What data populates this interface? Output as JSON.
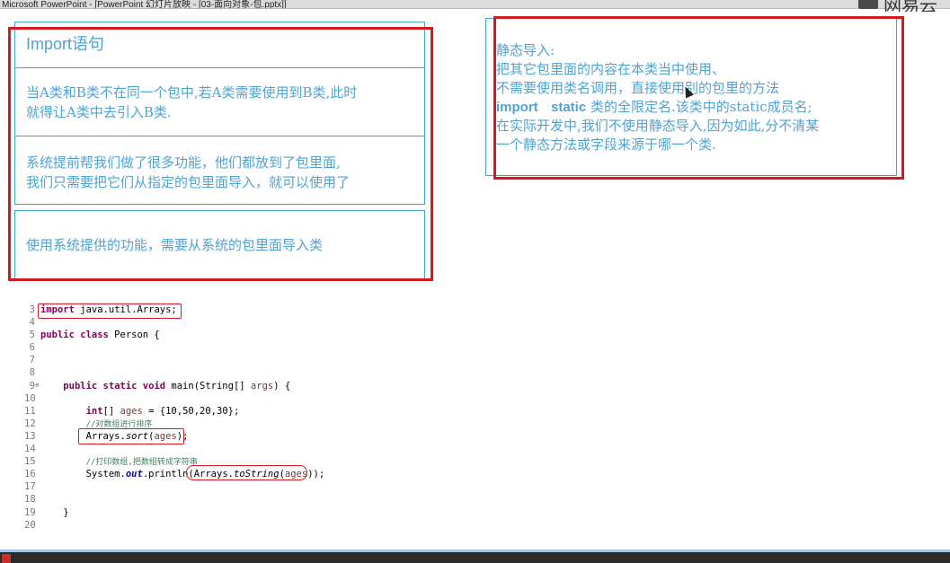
{
  "window": {
    "title": "Microsoft PowerPoint - [PowerPoint 幻灯片放映 - [03-面向对象-包.pptx]]"
  },
  "logo": {
    "text": "网易云"
  },
  "left_table": {
    "title": "Import语句",
    "row1": [
      "当A类和B类不在同一个包中,若A类需要使用到B类,此时",
      "就得让A类中去引入B类."
    ],
    "row2": [
      "系统提前帮我们做了很多功能，他们都放到了包里面,",
      "我们只需要把它们从指定的包里面导入，就可以使用了"
    ],
    "row3": [
      "使用系统提供的功能，需要从系统的包里面导入类"
    ]
  },
  "right_panel": {
    "line1": "静态导入:",
    "line2": "把其它包里面的内容在本类当中使用、",
    "line3": "不需要使用类名调用，直接使用别的包里的方法",
    "line4_kw1": "import",
    "line4_kw2": "static",
    "line4_rest": " 类的全限定名.该类中的static成员名;",
    "line5": "在实际开发中,我们不使用静态导入,因为如此,分不清某",
    "line6": "一个静态方法或字段来源于哪一个类."
  },
  "code": {
    "ln": [
      "3",
      "4",
      "5",
      "6",
      "7",
      "8",
      "9",
      "10",
      "11",
      "12",
      "13",
      "14",
      "15",
      "16",
      "17",
      "18",
      "19",
      "20"
    ],
    "l3_kw": "import",
    "l3_rest": " java.util.Arrays;",
    "l5_kw": "public class",
    "l5_rest": " Person {",
    "l9_kw": "public static void",
    "l9_rest": " main(String[] ",
    "l9_var": "args",
    "l9_end": ") {",
    "l11_kw": "int",
    "l11_rest": "[] ",
    "l11_var": "ages",
    "l11_end": " = {10,50,20,30};",
    "l12_comment": "//对数组进行排序",
    "l13_a": "Arrays.",
    "l13_m": "sort",
    "l13_b": "(",
    "l13_var": "ages",
    "l13_c": ");",
    "l15_comment": "//打印数组,把数组转成字符串",
    "l16_a": "System.",
    "l16_out": "out",
    "l16_b": ".println(",
    "l16_c": "Arrays.",
    "l16_m": "toString",
    "l16_d": "(",
    "l16_var": "ages",
    "l16_e": "));",
    "l19_text": "}",
    "fold_marker": "⊖"
  },
  "colors": {
    "accent_blue": "#4ea3d2",
    "border_blue": "#3ea6cf",
    "highlight_red": "#d7191e"
  }
}
